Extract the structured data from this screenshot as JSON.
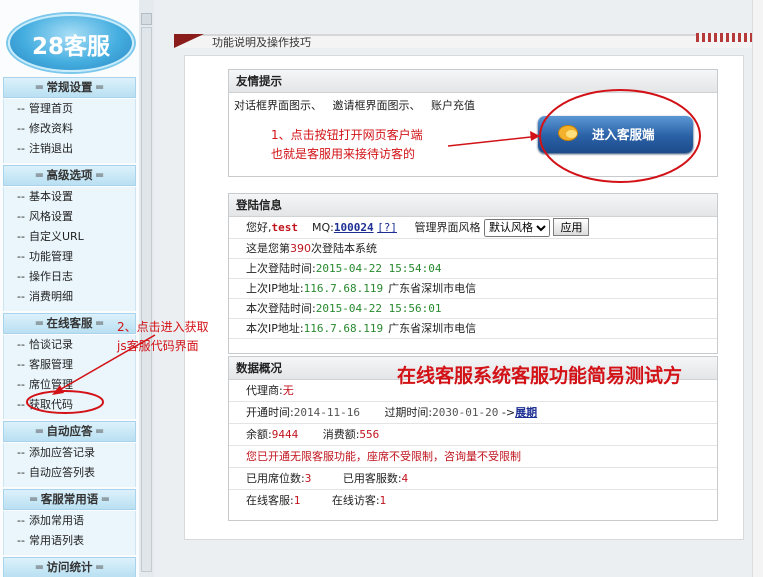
{
  "logo": {
    "text": "28客服"
  },
  "sidebar": {
    "sections": [
      {
        "title": "常规设置",
        "items": [
          "管理首页",
          "修改资料",
          "注销退出"
        ]
      },
      {
        "title": "高级选项",
        "items": [
          "基本设置",
          "风格设置",
          "自定义URL",
          "功能管理",
          "操作日志",
          "消费明细"
        ]
      },
      {
        "title": "在线客服",
        "items": [
          "恰谈记录",
          "客服管理",
          "席位管理",
          "获取代码"
        ]
      },
      {
        "title": "自动应答",
        "items": [
          "添加应答记录",
          "自动应答列表"
        ]
      },
      {
        "title": "客服常用语",
        "items": [
          "添加常用语",
          "常用语列表"
        ]
      },
      {
        "title": "访问统计",
        "items": []
      }
    ],
    "prefix": "--"
  },
  "topbar": {
    "title": "功能说明及操作技巧"
  },
  "tips": {
    "header": "友情提示",
    "links": [
      {
        "label": "对话框界面图示"
      },
      {
        "label": "邀请框界面图示"
      },
      {
        "label": "账户充值"
      }
    ],
    "sep": "、",
    "enter_button": "进入客服端"
  },
  "login": {
    "header": "登陆信息",
    "greeting": "您好,",
    "username": "test",
    "mq_label": "MQ:",
    "mq": "100024",
    "help": "[?]",
    "style_label": "管理界面风格",
    "style_value": "默认风格",
    "apply": "应用",
    "count_pre": "这是您第",
    "count": "390",
    "count_post": "次登陆本系统",
    "rows": [
      {
        "label": "上次登陆时间:",
        "value": "2015-04-22 15:54:04",
        "extra": ""
      },
      {
        "label": "上次IP地址:",
        "value": "116.7.68.119",
        "extra": "广东省深圳市电信"
      },
      {
        "label": "本次登陆时间:",
        "value": "2015-04-22 15:56:01",
        "extra": ""
      },
      {
        "label": "本次IP地址:",
        "value": "116.7.68.119",
        "extra": "广东省深圳市电信"
      }
    ]
  },
  "data": {
    "header": "数据概况",
    "agent_label": "代理商:",
    "agent": "无",
    "open_label": "开通时间:",
    "open_date": "2014-11-16",
    "expire_label": "过期时间:",
    "expire_date": "2030-01-20",
    "arrow": "->",
    "extend": "展期",
    "balance_label": "余额:",
    "balance": "9444",
    "spent_label": "消费额:",
    "spent": "556",
    "notice": "您已开通无限客服功能，座席不受限制，咨询量不受限制",
    "seats_label": "已用席位数:",
    "seats": "3",
    "agents_label": "已用客服数:",
    "agents": "4",
    "online_label": "在线客服:",
    "online": "1",
    "visitors_label": "在线访客:",
    "visitors": "1"
  },
  "annotations": {
    "a1_line1": "1、点击按钮打开网页客户端",
    "a1_line2": "也就是客服用来接待访客的",
    "a2_line1": "2、点击进入获取",
    "a2_line2": "js客服代码界面",
    "big": "在线客服系统客服功能简易测试方"
  },
  "colors": {
    "annotation": "#d21216",
    "accent_blue": "#2a61a6"
  }
}
